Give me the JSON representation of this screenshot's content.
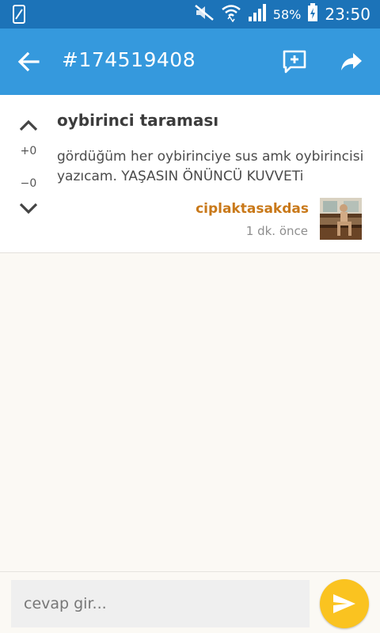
{
  "status_bar": {
    "battery_percent": "58%",
    "time": "23:50"
  },
  "app_bar": {
    "title": "#174519408"
  },
  "entry": {
    "title": "oybirinci taraması",
    "body": "gördüğüm her oybirinciye sus amk oybirincisi yazıcam. YAŞASIN ÖNÜNCÜ KUVVETi",
    "upvote_count": "+0",
    "downvote_count": "−0",
    "author": "ciplaktasakdas",
    "time_ago": "1 dk. önce"
  },
  "reply": {
    "placeholder": "cevap gir..."
  },
  "colors": {
    "status_bar": "#1c73b8",
    "app_bar": "#3599dd",
    "author": "#c9791a",
    "send_button": "#fac320",
    "background": "#fbf9f4"
  }
}
